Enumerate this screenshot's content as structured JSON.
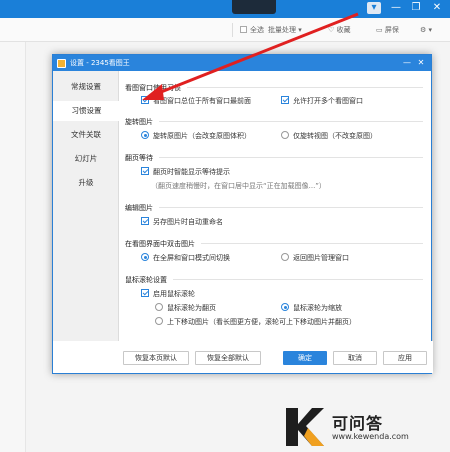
{
  "app": {
    "toolbar": {
      "select_all": "全选",
      "batch": "批量处理 ▾",
      "favorite": "收藏",
      "screen": "屏保",
      "more": "⚙ ▾"
    },
    "window_controls": {
      "menu": "▾",
      "minimize": "—",
      "maximize": "❐",
      "close": "✕"
    }
  },
  "dialog": {
    "title": "设置 - 2345看图王",
    "nav": [
      "常规设置",
      "习惯设置",
      "文件关联",
      "幻灯片",
      "升级"
    ],
    "active_nav": "习惯设置",
    "sections": {
      "habit": {
        "heading": "看图窗口使用习惯",
        "opt_top": "看图窗口总位于所有窗口最前面",
        "opt_multi": "允许打开多个看图窗口"
      },
      "rotate": {
        "heading": "旋转图片",
        "opt_real": "旋转原图片（会改变原图体积）",
        "opt_view": "仅旋转视图（不改变原图）"
      },
      "pageturn": {
        "heading": "翻页等待",
        "opt_smart": "翻页时智能显示等待提示",
        "hint": "（翻页速度稍慢时，在窗口居中显示“正在加载图像...”）"
      },
      "edit": {
        "heading": "编辑图片",
        "opt_rename": "另存图片时自动重命名"
      },
      "dblclick": {
        "heading": "在看图界面中双击图片",
        "opt_fullscreen": "在全屏和窗口模式间切换",
        "opt_back": "返回图片管理窗口"
      },
      "wheel": {
        "heading": "鼠标滚轮设置",
        "opt_enable": "启用鼠标滚轮",
        "opt_page": "鼠标滚轮为翻页",
        "opt_zoom": "鼠标滚轮为缩放",
        "opt_move": "上下移动图片（看长图更方便，滚轮可上下移动图片并翻页）"
      }
    },
    "buttons": {
      "restore_page": "恢复本页默认",
      "restore_all": "恢复全部默认",
      "ok": "确定",
      "cancel": "取消",
      "apply": "应用"
    }
  },
  "watermark": {
    "title": "可问答",
    "url": "www.kewenda.com"
  },
  "colors": {
    "accent": "#2a84dc",
    "arrow": "#e02020"
  }
}
